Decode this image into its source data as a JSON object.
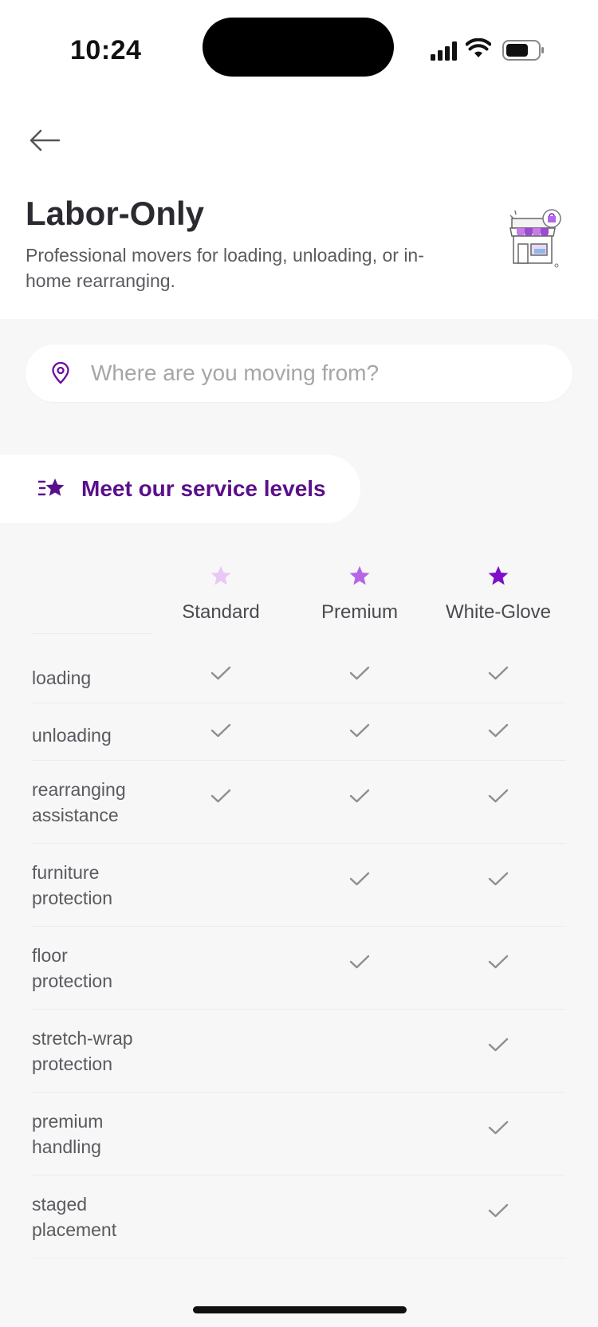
{
  "status_bar": {
    "time": "10:24"
  },
  "header": {
    "title": "Labor-Only",
    "subtitle": "Professional movers for loading, unloading, or in-home rearranging."
  },
  "search": {
    "placeholder": "Where are you moving from?"
  },
  "service_levels_pill": {
    "label": "Meet our service levels"
  },
  "levels": [
    {
      "name": "Standard",
      "star_color": "#e8c8f4"
    },
    {
      "name": "Premium",
      "star_color": "#b566e6"
    },
    {
      "name": "White-Glove",
      "star_color": "#7d10c8"
    }
  ],
  "features": [
    {
      "label": "loading",
      "standard": true,
      "premium": true,
      "white_glove": true
    },
    {
      "label": "unloading",
      "standard": true,
      "premium": true,
      "white_glove": true
    },
    {
      "label": "rearranging assistance",
      "standard": true,
      "premium": true,
      "white_glove": true
    },
    {
      "label": "furniture protection",
      "standard": false,
      "premium": true,
      "white_glove": true
    },
    {
      "label": "floor protection",
      "standard": false,
      "premium": true,
      "white_glove": true
    },
    {
      "label": "stretch-wrap protection",
      "standard": false,
      "premium": false,
      "white_glove": true
    },
    {
      "label": "premium handling",
      "standard": false,
      "premium": false,
      "white_glove": true
    },
    {
      "label": "staged placement",
      "standard": false,
      "premium": false,
      "white_glove": true
    }
  ],
  "colors": {
    "accent": "#5a0f8a",
    "check": "#8e8e93"
  }
}
